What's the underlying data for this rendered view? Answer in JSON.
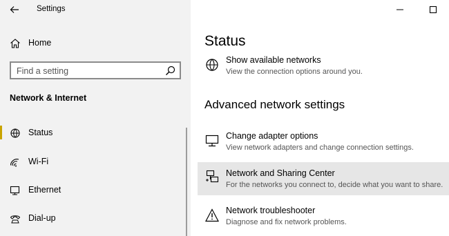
{
  "window": {
    "title": "Settings",
    "back_icon": "back-arrow-icon",
    "minimize_icon": "minimize-icon",
    "maximize_icon": "maximize-icon"
  },
  "sidebar": {
    "home_label": "Home",
    "search_placeholder": "Find a setting",
    "section_title": "Network & Internet",
    "items": [
      {
        "label": "Status",
        "icon": "status-icon",
        "selected": true
      },
      {
        "label": "Wi-Fi",
        "icon": "wifi-icon",
        "selected": false
      },
      {
        "label": "Ethernet",
        "icon": "ethernet-icon",
        "selected": false
      },
      {
        "label": "Dial-up",
        "icon": "dialup-icon",
        "selected": false
      }
    ],
    "accent_color": "#c9a400"
  },
  "main": {
    "title": "Status",
    "top_link": {
      "title": "Show available networks",
      "desc": "View the connection options around you."
    },
    "advanced_title": "Advanced network settings",
    "advanced_links": [
      {
        "title": "Change adapter options",
        "desc": "View network adapters and change connection settings.",
        "icon": "adapter-icon"
      },
      {
        "title": "Network and Sharing Center",
        "desc": "For the networks you connect to, decide what you want to share.",
        "icon": "sharing-center-icon"
      },
      {
        "title": "Network troubleshooter",
        "desc": "Diagnose and fix network problems.",
        "icon": "warning-icon"
      }
    ]
  }
}
